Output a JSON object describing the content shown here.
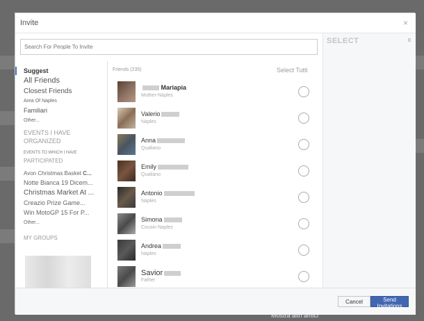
{
  "dialog": {
    "title": "Invite",
    "close_glyph": "×",
    "search_placeholder": "Search For People To Invite"
  },
  "categories": {
    "suggest": "Suggest",
    "all_friends": "All Friends",
    "closest_friends": "Closest Friends",
    "area": "Area Of Naples",
    "family": "Familiari",
    "other1": "Other...",
    "events_organized_1": "EVENTS I HAVE",
    "events_organized_2": "ORGANIZED",
    "events_participated_1": "EVENTS TO WHICH I HAVE",
    "events_participated_2": "PARTICIPATED",
    "event1": "Avon Christmas Basket",
    "event1_suffix": "C...",
    "event2": "Notte Bianca 19 Dicem...",
    "event3": "Christmas Market At ...",
    "event4": "Creazio Prize Game...",
    "event5": "Win MotoGP 15 For P...",
    "other2": "Other...",
    "groups": "MY GROUPS"
  },
  "friends": {
    "count_label": "Friends (235)",
    "select_all": "Select Tutti",
    "list": [
      {
        "name": "Mariapia",
        "sub": "Mother-Naples"
      },
      {
        "name": "Valerio",
        "sub": "Naples"
      },
      {
        "name": "Anna",
        "sub": "Qualiano"
      },
      {
        "name": "Emily",
        "sub": "Qualiano"
      },
      {
        "name": "Antonio",
        "sub": "Naples"
      },
      {
        "name": "Simona",
        "sub": "Cousin-Naples"
      },
      {
        "name": "Andrea",
        "sub": "Naples"
      },
      {
        "name": "Savior",
        "sub": "Father"
      }
    ]
  },
  "selection": {
    "title": "SELECT",
    "count": "0"
  },
  "footer": {
    "cancel": "Cancel",
    "send": "Send Invitations"
  },
  "background": {
    "more_friends": "Mostra altri amici"
  },
  "colors": {
    "accent": "#4267b2",
    "overlay": "#6a6a6a"
  }
}
